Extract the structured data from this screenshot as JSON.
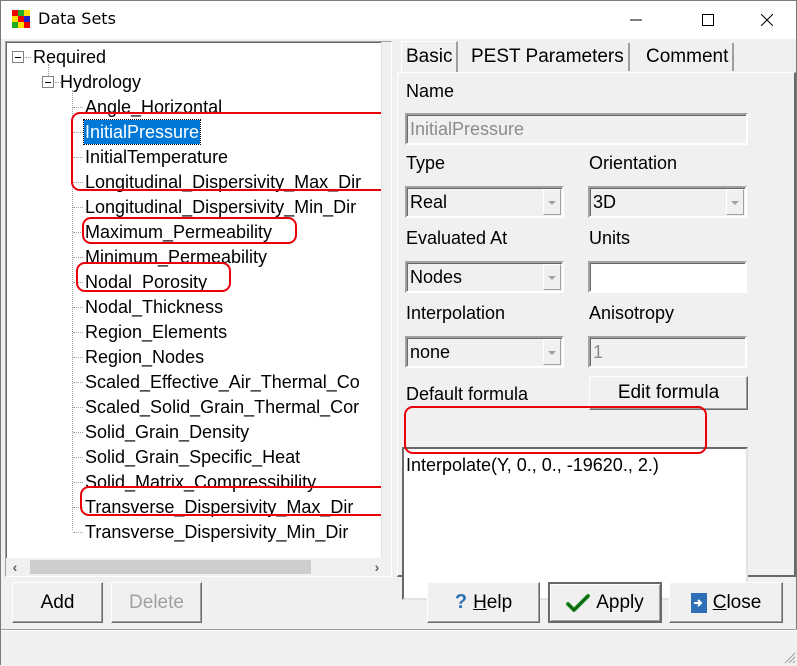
{
  "window": {
    "title": "Data Sets",
    "app_icon": "grid-color-icon",
    "controls": {
      "minimize": "minimize-icon",
      "maximize": "maximize-icon",
      "close": "close-icon"
    }
  },
  "tree": {
    "root": {
      "label": "Required",
      "expanded": true
    },
    "group": {
      "label": "Hydrology",
      "expanded": true
    },
    "items": [
      {
        "label": "Angle_Horizontal",
        "selected": false,
        "highlighted": false
      },
      {
        "label": "InitialPressure",
        "selected": true,
        "highlighted": true
      },
      {
        "label": "InitialTemperature",
        "selected": false,
        "highlighted": true
      },
      {
        "label": "Longitudinal_Dispersivity_Max_Dir",
        "selected": false,
        "highlighted": true
      },
      {
        "label": "Longitudinal_Dispersivity_Min_Dir",
        "selected": false,
        "highlighted": false
      },
      {
        "label": "Maximum_Permeability",
        "selected": false,
        "highlighted": true
      },
      {
        "label": "Minimum_Permeability",
        "selected": false,
        "highlighted": false
      },
      {
        "label": "Nodal_Porosity",
        "selected": false,
        "highlighted": true
      },
      {
        "label": "Nodal_Thickness",
        "selected": false,
        "highlighted": false
      },
      {
        "label": "Region_Elements",
        "selected": false,
        "highlighted": false
      },
      {
        "label": "Region_Nodes",
        "selected": false,
        "highlighted": false
      },
      {
        "label": "Scaled_Effective_Air_Thermal_Co",
        "selected": false,
        "highlighted": false
      },
      {
        "label": "Scaled_Solid_Grain_Thermal_Cor",
        "selected": false,
        "highlighted": false
      },
      {
        "label": "Solid_Grain_Density",
        "selected": false,
        "highlighted": false
      },
      {
        "label": "Solid_Grain_Specific_Heat",
        "selected": false,
        "highlighted": false
      },
      {
        "label": "Solid_Matrix_Compressibility",
        "selected": false,
        "highlighted": false
      },
      {
        "label": "Transverse_Dispersivity_Max_Dir",
        "selected": false,
        "highlighted": true
      },
      {
        "label": "Transverse_Dispersivity_Min_Dir",
        "selected": false,
        "highlighted": false
      }
    ],
    "scroll_left": "‹",
    "scroll_right": "›"
  },
  "tabs": [
    {
      "label": "Basic",
      "active": true
    },
    {
      "label": "PEST Parameters",
      "active": false
    },
    {
      "label": "Comment",
      "active": false
    }
  ],
  "basic": {
    "name_label": "Name",
    "name_value": "InitialPressure",
    "type_label": "Type",
    "type_value": "Real",
    "orientation_label": "Orientation",
    "orientation_value": "3D",
    "evaluated_at_label": "Evaluated At",
    "evaluated_at_value": "Nodes",
    "units_label": "Units",
    "units_value": "",
    "interpolation_label": "Interpolation",
    "interpolation_value": "none",
    "anisotropy_label": "Anisotropy",
    "anisotropy_value": "1",
    "default_formula_label": "Default formula",
    "edit_formula_button": "Edit formula",
    "formula_value": "Interpolate(Y, 0., 0., -19620., 2.)"
  },
  "buttons": {
    "add": "Add",
    "delete": "Delete",
    "help_prefix": "",
    "help_hotkey": "H",
    "help_rest": "elp",
    "apply": "Apply",
    "close_hotkey": "C",
    "close_rest": "lose"
  },
  "colors": {
    "selection": "#0078d7",
    "highlight_box": "#e8000b",
    "help_icon": "#2e6fb5",
    "apply_check": "#1a8a1a",
    "close_icon": "#2e6fb5"
  }
}
